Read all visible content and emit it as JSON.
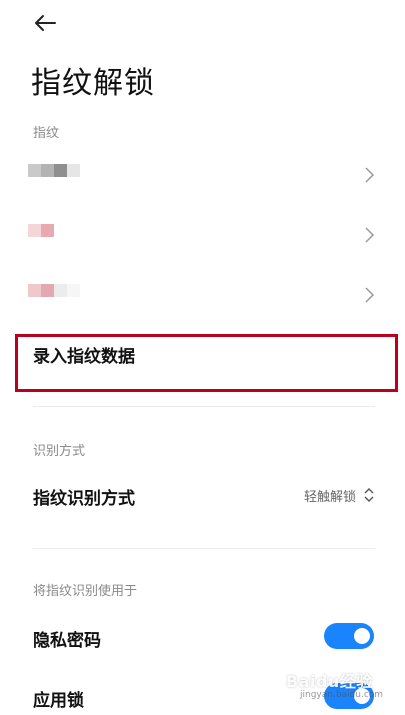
{
  "header": {
    "back_icon": "arrow-left-icon",
    "title": "指纹解锁"
  },
  "fingerprints": {
    "section_label": "指纹",
    "items": [
      {
        "name": "",
        "chevron_icon": "chevron-right-icon"
      },
      {
        "name": "",
        "chevron_icon": "chevron-right-icon"
      },
      {
        "name": "",
        "chevron_icon": "chevron-right-icon"
      }
    ],
    "enroll_label": "录入指纹数据",
    "highlight_color": "#b9001f"
  },
  "recognition": {
    "section_label": "识别方式",
    "method_label": "指纹识别方式",
    "method_value": "轻触解锁",
    "method_icon": "unfold-icon"
  },
  "usage": {
    "section_label": "将指纹识别使用于",
    "privacy_label": "隐私密码",
    "privacy_enabled": true,
    "applock_label": "应用锁",
    "applock_enabled": true,
    "toggle_color": "#1a84ff"
  },
  "watermark": {
    "logo": "Baidu经验",
    "url": "jingyan.baidu.com"
  }
}
